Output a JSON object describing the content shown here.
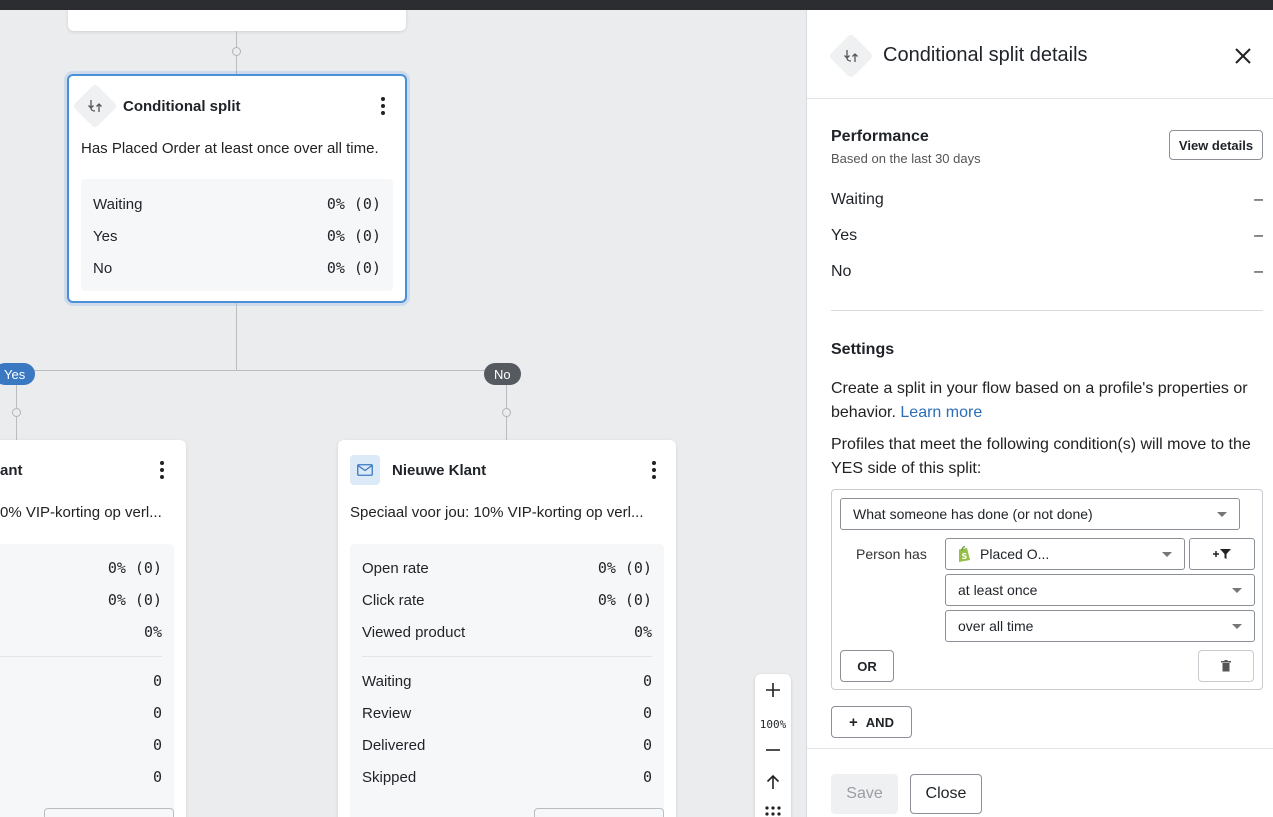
{
  "canvas": {
    "split_card": {
      "title": "Conditional split",
      "description": "Has Placed Order at least once over all time.",
      "stats": [
        {
          "label": "Waiting",
          "value": "0% (0)"
        },
        {
          "label": "Yes",
          "value": "0% (0)"
        },
        {
          "label": "No",
          "value": "0% (0)"
        }
      ]
    },
    "branch_yes": "Yes",
    "branch_no": "No",
    "left_card": {
      "title": "ant",
      "description": "0% VIP-korting op verl...",
      "stats_top": [
        "0% (0)",
        "0% (0)",
        "0%"
      ],
      "stats_bottom": [
        "0",
        "0",
        "0",
        "0"
      ]
    },
    "right_card": {
      "title": "Nieuwe Klant",
      "description": "Speciaal voor jou: 10% VIP-korting op verl...",
      "stats_top": [
        {
          "label": "Open rate",
          "value": "0% (0)"
        },
        {
          "label": "Click rate",
          "value": "0% (0)"
        },
        {
          "label": "Viewed product",
          "value": "0%"
        }
      ],
      "stats_bottom": [
        {
          "label": "Waiting",
          "value": "0"
        },
        {
          "label": "Review",
          "value": "0"
        },
        {
          "label": "Delivered",
          "value": "0"
        },
        {
          "label": "Skipped",
          "value": "0"
        }
      ]
    },
    "zoom": {
      "level": "100%"
    }
  },
  "panel": {
    "title": "Conditional split details",
    "performance": {
      "heading": "Performance",
      "subtitle": "Based on the last 30 days",
      "view_details": "View details",
      "rows": [
        {
          "label": "Waiting",
          "value": "–"
        },
        {
          "label": "Yes",
          "value": "–"
        },
        {
          "label": "No",
          "value": "–"
        }
      ]
    },
    "settings": {
      "heading": "Settings",
      "intro": "Create a split in your flow based on a profile's properties or behavior.",
      "learn_more": "Learn more",
      "condition_intro": "Profiles that meet the following condition(s) will move to the YES side of this split:",
      "condition_type": "What someone has done (or not done)",
      "person_has": "Person has",
      "metric": "Placed O...",
      "frequency": "at least once",
      "timeframe": "over all time",
      "or_label": "OR",
      "and_label": "AND"
    },
    "footer": {
      "save": "Save",
      "close": "Close"
    }
  },
  "colors": {
    "accent": "#2a6eb8",
    "yes_pill": "#3a78c2",
    "no_pill": "#555a60",
    "selected_border": "#4a90d9"
  }
}
